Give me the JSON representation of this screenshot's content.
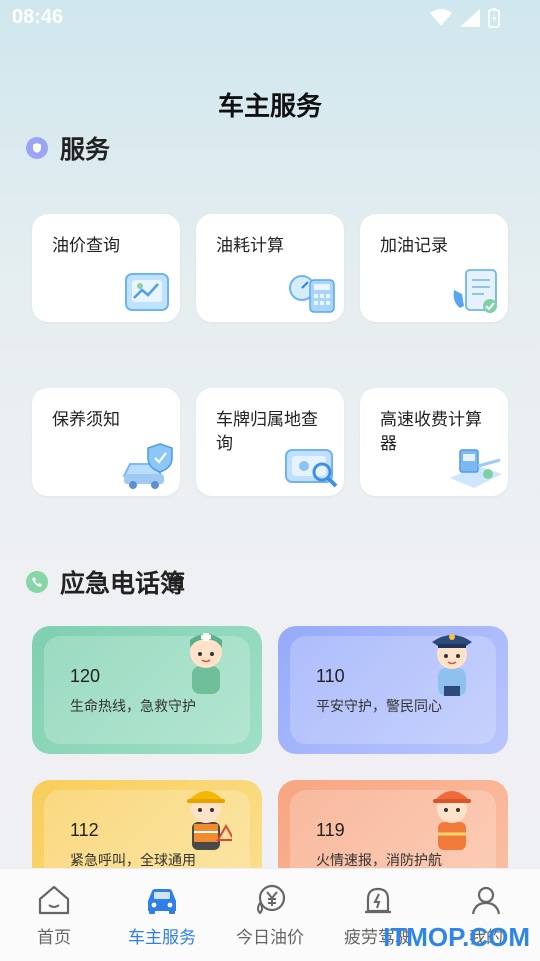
{
  "status": {
    "time": "08:46"
  },
  "header": {
    "title": "车主服务"
  },
  "services": {
    "title": "服务",
    "items": [
      {
        "label": "油价查询",
        "icon": "price-chart-icon"
      },
      {
        "label": "油耗计算",
        "icon": "calculator-icon"
      },
      {
        "label": "加油记录",
        "icon": "fuel-record-icon"
      },
      {
        "label": "保养须知",
        "icon": "car-shield-icon"
      },
      {
        "label": "车牌归属地查询",
        "icon": "plate-search-icon"
      },
      {
        "label": "高速收费计算器",
        "icon": "toll-booth-icon"
      }
    ]
  },
  "emergency": {
    "title": "应急电话簿",
    "items": [
      {
        "number": "120",
        "desc": "生命热线，急救守护",
        "color": "#8fd6b8"
      },
      {
        "number": "110",
        "desc": "平安守护，警民同心",
        "color": "#a7b7fb"
      },
      {
        "number": "112",
        "desc": "紧急呼叫，全球通用",
        "color": "#fbd36b"
      },
      {
        "number": "119",
        "desc": "火情速报，消防护航",
        "color": "#f9b08e"
      }
    ]
  },
  "tabbar": {
    "items": [
      {
        "label": "首页",
        "icon": "home-icon"
      },
      {
        "label": "车主服务",
        "icon": "car-icon"
      },
      {
        "label": "今日油价",
        "icon": "yuan-drop-icon"
      },
      {
        "label": "疲劳驾驶",
        "icon": "warning-lamp-icon"
      },
      {
        "label": "我的",
        "icon": "user-icon"
      }
    ],
    "active_index": 1
  },
  "watermark": "ITMOP.COM",
  "colors": {
    "accent": "#2f7fe6"
  }
}
